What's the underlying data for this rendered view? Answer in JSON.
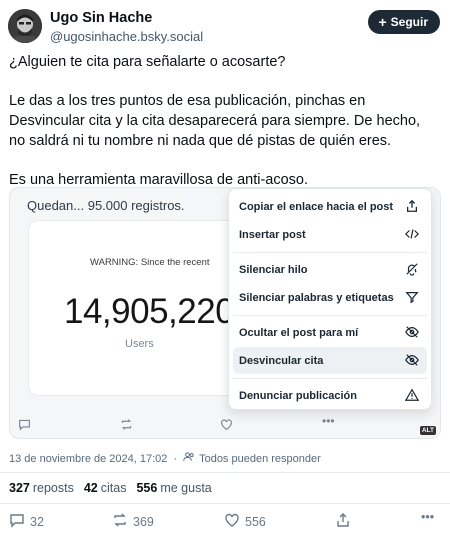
{
  "author": {
    "display_name": "Ugo Sin Hache",
    "handle": "@ugosinhache.bsky.social",
    "follow_label": "Seguir"
  },
  "post": {
    "paragraphs": [
      "¿Alguien te cita para señalarte o acosarte?",
      "Le das a los tres puntos de esa publicación, pinchas en Desvincular cita y la cita desaparecerá para siempre. De hecho, no saldrá ni tu nombre ni nada que dé pistas de quién eres.",
      "Es una herramienta maravillosa de anti-acoso."
    ]
  },
  "embed": {
    "quedan_text": "Quedan... 95.000 registros.",
    "warning_text": "WARNING: Since the recent",
    "big_number": "14,905,220",
    "users_label": "Users",
    "alt_label": "ALT"
  },
  "menu": {
    "items": [
      {
        "label": "Copiar el enlace hacia el post",
        "icon": "share-icon"
      },
      {
        "label": "Insertar post",
        "icon": "code-icon"
      },
      {
        "label": "Silenciar hilo",
        "icon": "bell-off-icon"
      },
      {
        "label": "Silenciar palabras y etiquetas",
        "icon": "filter-icon"
      },
      {
        "label": "Ocultar el post para mí",
        "icon": "eye-off-icon"
      },
      {
        "label": "Desvincular cita",
        "icon": "eye-off-icon"
      },
      {
        "label": "Denunciar publicación",
        "icon": "warning-icon"
      }
    ]
  },
  "meta": {
    "timestamp": "13 de noviembre de 2024, 17:02",
    "reply_setting": "Todos pueden responder"
  },
  "stats": {
    "reposts_count": "327",
    "reposts_label": "reposts",
    "quotes_count": "42",
    "quotes_label": "citas",
    "likes_count": "556",
    "likes_label": "me gusta"
  },
  "actions": {
    "reply_count": "32",
    "repost_count": "369",
    "like_count": "556"
  }
}
